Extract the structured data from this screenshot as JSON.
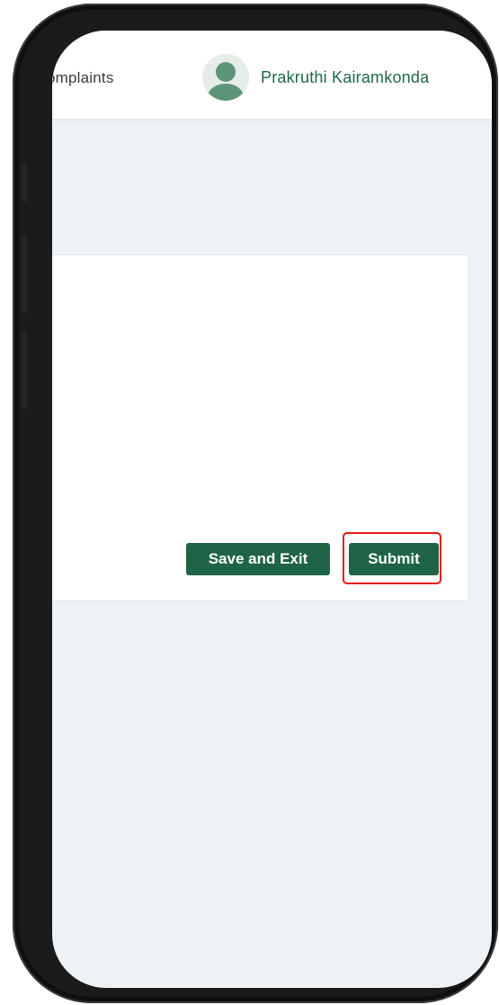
{
  "header": {
    "nav_item": "omplaints",
    "user_name": "Prakruthi Kairamkonda",
    "avatar_icon": "user-avatar-icon"
  },
  "form": {
    "save_and_exit_label": "Save and Exit",
    "submit_label": "Submit"
  },
  "colors": {
    "brand_green": "#1f6446",
    "name_green": "#1e6a46",
    "highlight_red": "#e41818",
    "page_background": "#eff2f5"
  }
}
